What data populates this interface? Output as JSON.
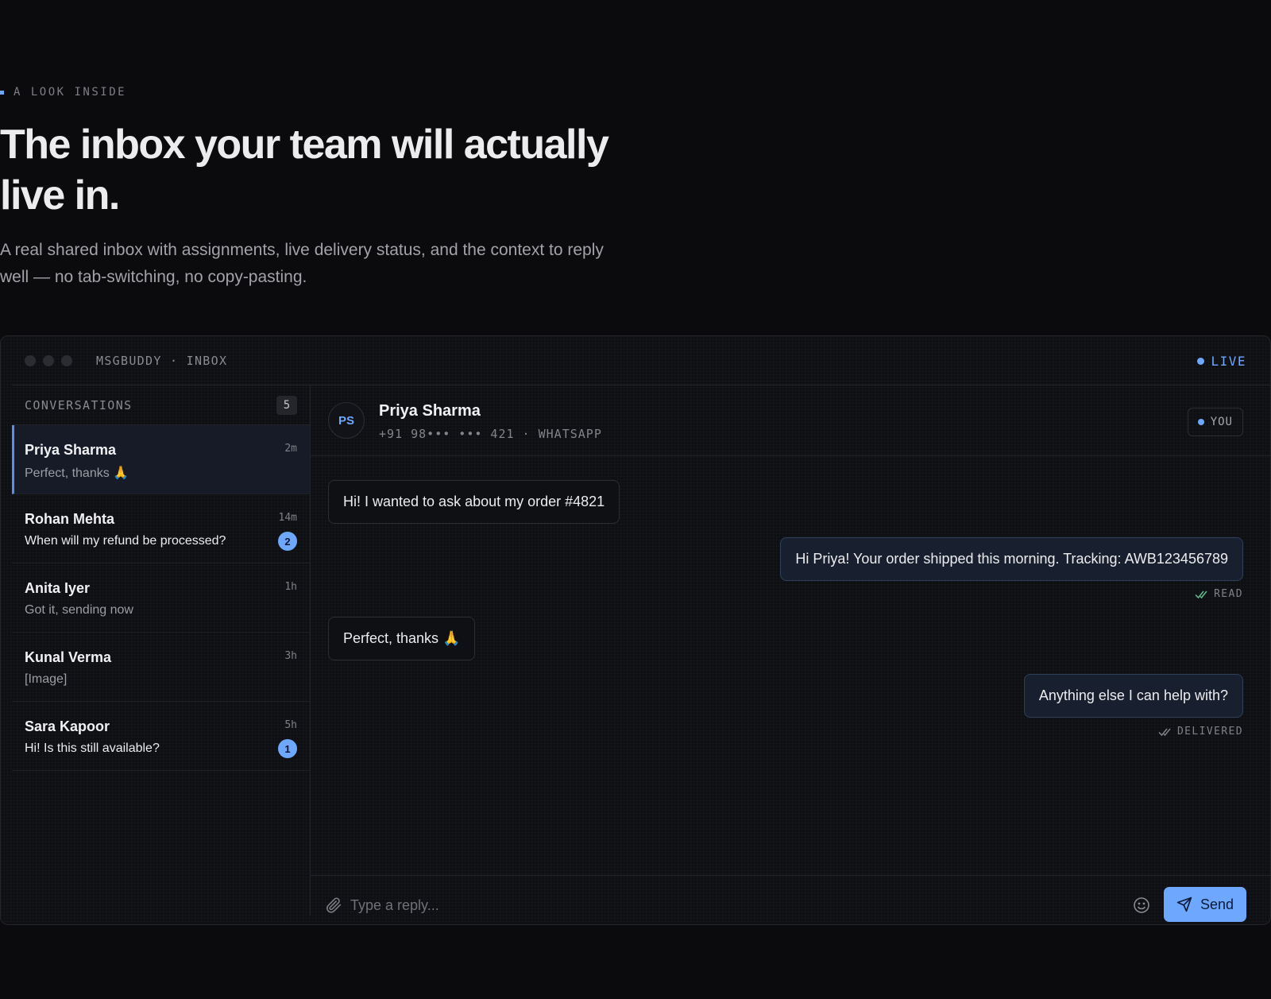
{
  "hero": {
    "eyebrow": "A LOOK INSIDE",
    "headline": "The inbox your team will actually live in.",
    "subhead": "A real shared inbox with assignments, live delivery status, and the context to reply well — no tab-switching, no copy-pasting."
  },
  "window": {
    "title": "MSGBUDDY · INBOX",
    "live_label": "LIVE"
  },
  "sidebar": {
    "header": "CONVERSATIONS",
    "count": "5",
    "conversations": [
      {
        "name": "Priya Sharma",
        "time": "2m",
        "preview": "Perfect, thanks 🙏",
        "badge": ""
      },
      {
        "name": "Rohan Mehta",
        "time": "14m",
        "preview": "When will my refund be processed?",
        "badge": "2"
      },
      {
        "name": "Anita Iyer",
        "time": "1h",
        "preview": "Got it, sending now",
        "badge": ""
      },
      {
        "name": "Kunal Verma",
        "time": "3h",
        "preview": "[Image]",
        "badge": ""
      },
      {
        "name": "Sara Kapoor",
        "time": "5h",
        "preview": "Hi! Is this still available?",
        "badge": "1"
      }
    ]
  },
  "chat": {
    "avatar_initials": "PS",
    "contact_name": "Priya Sharma",
    "contact_meta": "+91 98••• ••• 421 · WHATSAPP",
    "assignee": "YOU",
    "messages": [
      {
        "direction": "in",
        "text": "Hi! I wanted to ask about my order #4821"
      },
      {
        "direction": "out",
        "text": "Hi Priya! Your order shipped this morning. Tracking: AWB123456789",
        "status": "READ"
      },
      {
        "direction": "in",
        "text": "Perfect, thanks 🙏"
      },
      {
        "direction": "out",
        "text": "Anything else I can help with?",
        "status": "DELIVERED"
      }
    ],
    "composer": {
      "placeholder": "Type a reply...",
      "send_label": "Send"
    }
  },
  "colors": {
    "accent": "#6ea8fe",
    "background": "#0b0b0d",
    "read_check": "#5fbf8f"
  },
  "icons": [
    "paperclip-icon",
    "smiley-icon",
    "send-icon",
    "double-check-icon"
  ]
}
